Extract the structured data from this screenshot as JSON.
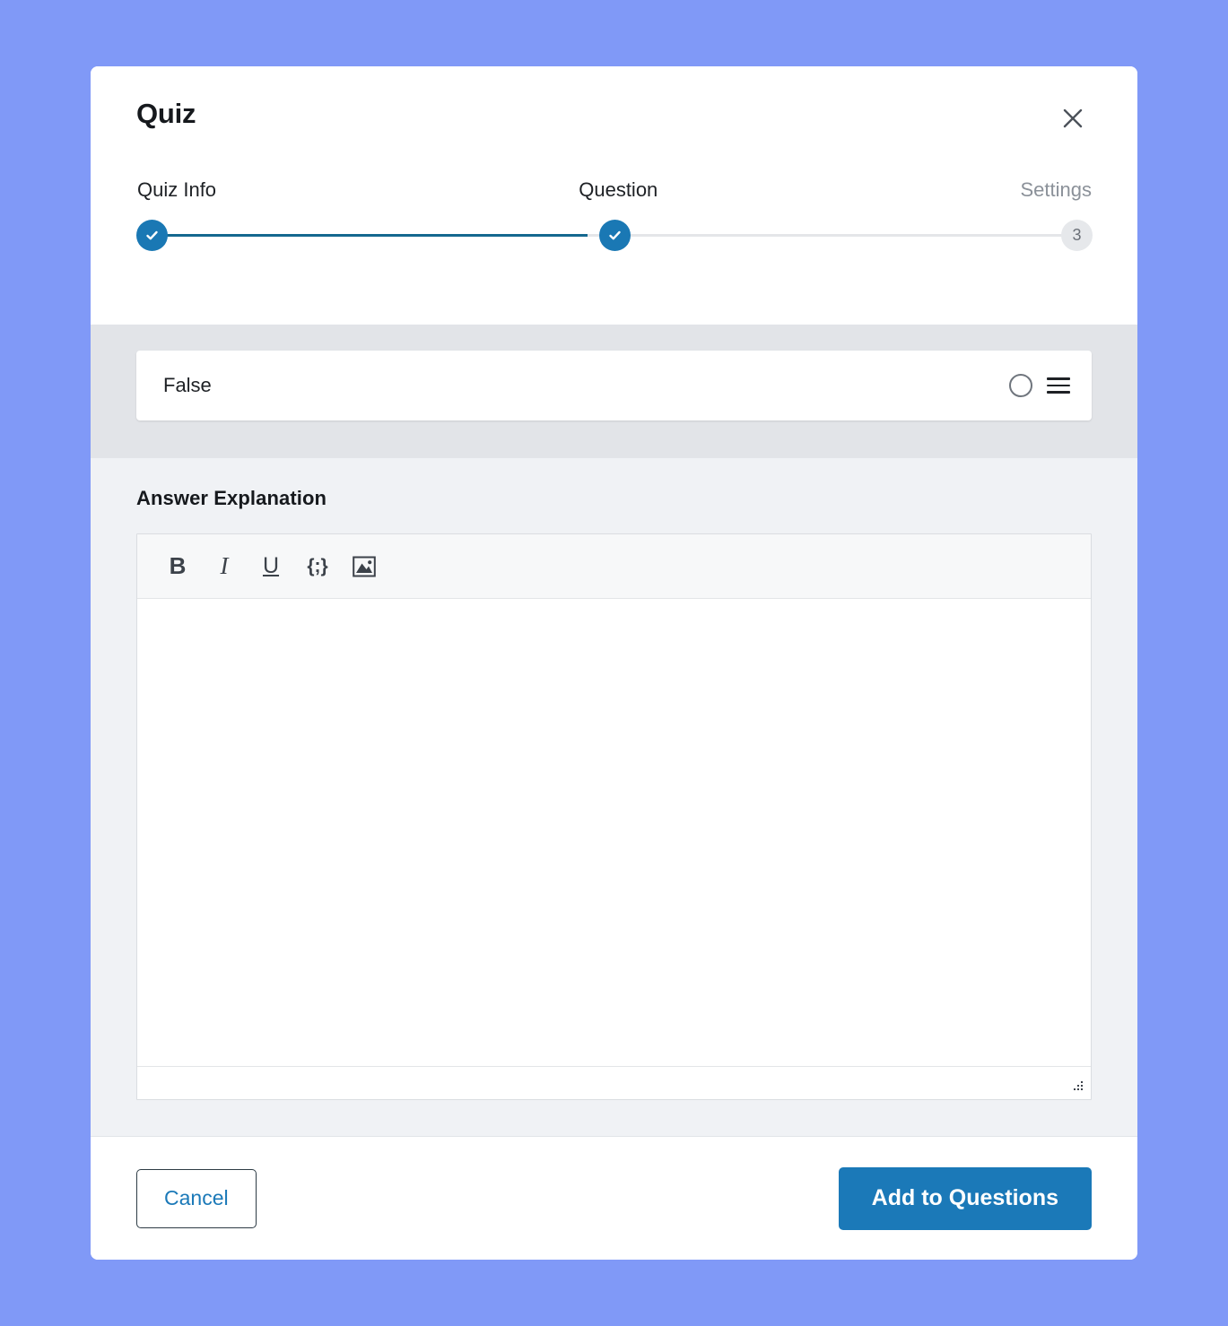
{
  "background_color": "#8099f7",
  "modal": {
    "title": "Quiz",
    "close_icon": "close-icon",
    "stepper": {
      "steps": [
        {
          "label": "Quiz Info",
          "state": "done",
          "marker": "check-icon"
        },
        {
          "label": "Question",
          "state": "done",
          "marker": "check-icon"
        },
        {
          "label": "Settings",
          "state": "todo",
          "marker": "3"
        }
      ],
      "active_color": "#1a78b4",
      "inactive_color": "#e6e8eb",
      "track_filled_color": "#15688f"
    },
    "answer": {
      "text": "False",
      "radio_icon": "radio-unchecked-icon",
      "drag_icon": "drag-handle-icon"
    },
    "explanation": {
      "label": "Answer Explanation",
      "toolbar": [
        {
          "name": "bold-icon",
          "glyph": "B",
          "label": "Bold"
        },
        {
          "name": "italic-icon",
          "glyph": "I",
          "label": "Italic"
        },
        {
          "name": "underline-icon",
          "glyph": "U",
          "label": "Underline"
        },
        {
          "name": "code-icon",
          "glyph": "{;}",
          "label": "Code"
        },
        {
          "name": "image-icon",
          "glyph": "",
          "label": "Insert Image"
        }
      ],
      "editor_value": "",
      "editor_placeholder": "",
      "resize_icon": "resize-grip-icon"
    },
    "footer": {
      "cancel_label": "Cancel",
      "submit_label": "Add to Questions",
      "cancel_color": "#1b79b8",
      "submit_color": "#1b79b8"
    }
  }
}
